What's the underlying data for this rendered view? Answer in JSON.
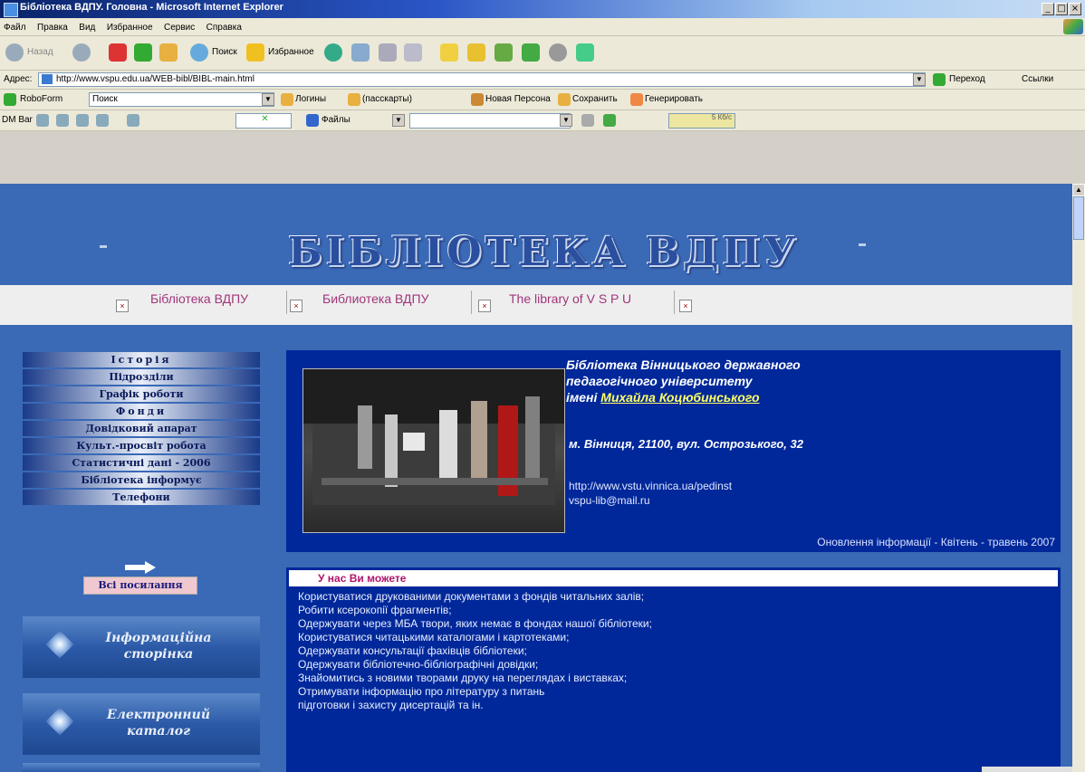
{
  "window": {
    "title": "Бібліотека ВДПУ. Головна - Microsoft Internet Explorer",
    "controls": [
      "_",
      "□",
      "×"
    ]
  },
  "menu": [
    "Файл",
    "Правка",
    "Вид",
    "Избранное",
    "Сервис",
    "Справка"
  ],
  "toolbar": {
    "back": "Назад",
    "search": "Поиск",
    "favorites": "Избранное"
  },
  "address": {
    "label": "Адрес:",
    "url": "http://www.vspu.edu.ua/WEB-bibl/BIBL-main.html",
    "go": "Переход",
    "links": "Ссылки"
  },
  "roboform": {
    "brand": "RoboForm",
    "search_value": "Поиск",
    "logins": "Логины",
    "passcards": "(пасскарты)",
    "new_identity": "Новая Персона",
    "save": "Сохранить",
    "generate": "Генерировать"
  },
  "dmbar": {
    "label": "DM Bar",
    "files": "Файлы",
    "meter": "5 Кб/с"
  },
  "page": {
    "banner": "БІБЛІОТЕКА ВДПУ",
    "tabs": [
      "Бібліотека ВДПУ",
      "Библиотека ВДПУ",
      "The library of V S P U"
    ],
    "nav": [
      "Історія",
      "Підрозділи",
      "Графік роботи",
      "Фонди",
      "Довідковий апарат",
      "Культ.-просвіт робота",
      "Статистичні дані - 2006",
      "Бібліотека інформує",
      "Телефони"
    ],
    "all_links": "Всі посилання",
    "info_page": "Інформаційна сторінка",
    "e_catalog": "Електронний каталог",
    "library_title": [
      "Бібліотека Вінницького державного",
      "педагогічного університету",
      "імені "
    ],
    "library_name_link": "Михайла Коцюбинського",
    "address": "м. Вінниця, 21100,  вул. Острозького, 32",
    "website": "http://www.vstu.vinnica.ua/pedinst",
    "email": "vspu-lib@mail.ru",
    "updated": "Оновлення інформації - Квітень - травень 2007",
    "you_can_header": "У нас Ви  можете",
    "you_can": [
      "Користуватися друкованими документами з фондів читальних залів;",
      "Робити ксерокопії фрагментів;",
      "Одержувати через МБА твори, яких немає в фондах нашої бібліотеки;",
      "Користуватися читацькими каталогами і картотеками;",
      "Одержувати консультації фахівців бібліотеки;",
      "Одержувати бібліотечно-бібліографічні довідки;",
      "Знайомитись з новими творами друку на переглядах і виставках;",
      "Отримувати інформацію про літературу з питань",
      "підготовки і захисту дисертацій та ін."
    ]
  }
}
